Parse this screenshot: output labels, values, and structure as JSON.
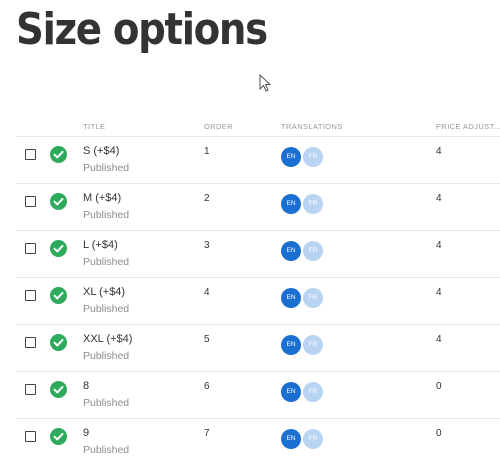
{
  "page": {
    "title": "Size options"
  },
  "table": {
    "columns": {
      "title": "TITLE",
      "order": "ORDER",
      "translations": "TRANSLATIONS",
      "price": "PRICE ADJUST..."
    },
    "rows": [
      {
        "title": "S (+$4)",
        "status": "Published",
        "order": "1",
        "en": "EN",
        "fr": "FR",
        "price": "4"
      },
      {
        "title": "M (+$4)",
        "status": "Published",
        "order": "2",
        "en": "EN",
        "fr": "FR",
        "price": "4"
      },
      {
        "title": "L (+$4)",
        "status": "Published",
        "order": "3",
        "en": "EN",
        "fr": "FR",
        "price": "4"
      },
      {
        "title": "XL (+$4)",
        "status": "Published",
        "order": "4",
        "en": "EN",
        "fr": "FR",
        "price": "4"
      },
      {
        "title": "XXL (+$4)",
        "status": "Published",
        "order": "5",
        "en": "EN",
        "fr": "FR",
        "price": "4"
      },
      {
        "title": "8",
        "status": "Published",
        "order": "6",
        "en": "EN",
        "fr": "FR",
        "price": "0"
      },
      {
        "title": "9",
        "status": "Published",
        "order": "7",
        "en": "EN",
        "fr": "FR",
        "price": "0"
      }
    ]
  },
  "colors": {
    "published_green": "#2eaa5c",
    "lang_active": "#1a6fd0",
    "lang_inactive": "#b9d3f3"
  }
}
